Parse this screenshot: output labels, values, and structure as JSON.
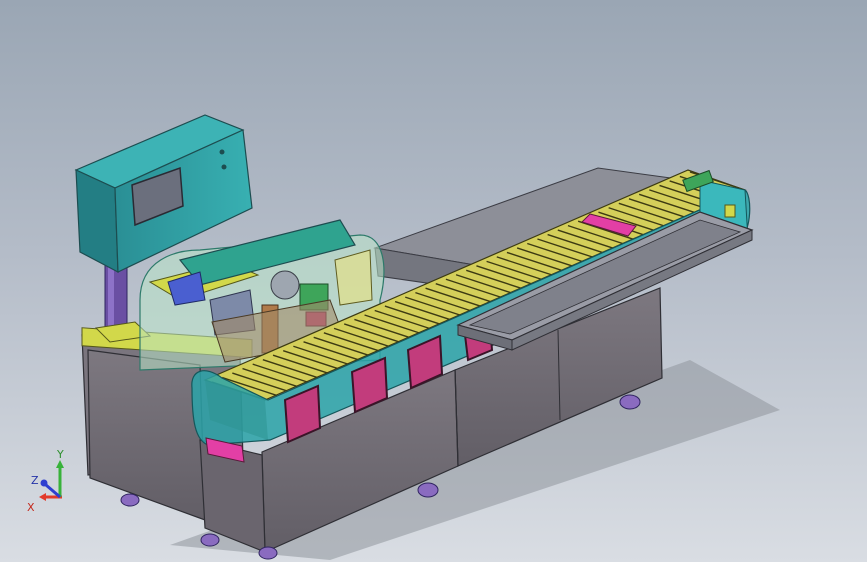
{
  "viewport": {
    "background_top": "#9aa6b4",
    "background_bottom": "#d9dde3",
    "model": {
      "colors": {
        "control_box": "#2f9ea3",
        "control_screen": "#6b6f7d",
        "column": "#6a4fa3",
        "base_cabinet": "#6f6b74",
        "conveyor_links": "#d4cf5a",
        "side_panel": "#2aa3a8",
        "access_panel": "#c23c7c",
        "tray": "#8d8f98",
        "casters": "#8a6bc0",
        "guard_glass": "#b9e6c8",
        "top_plate": "#d2d84a",
        "motor_green": "#3ea55a"
      }
    },
    "triad": {
      "x_label": "X",
      "y_label": "Y",
      "z_label": "Z",
      "x_color": "#e23a2a",
      "y_color": "#38b23a",
      "z_color": "#2e3fd0"
    }
  }
}
